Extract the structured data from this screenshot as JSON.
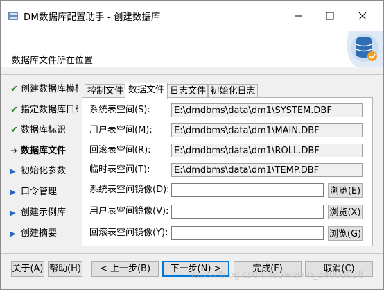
{
  "window": {
    "title": "DM数据库配置助手 - 创建数据库"
  },
  "banner": {
    "title": "数据库文件所在位置"
  },
  "steps": [
    {
      "label": "创建数据库模板",
      "state": "done"
    },
    {
      "label": "指定数据库目录",
      "state": "done"
    },
    {
      "label": "数据库标识",
      "state": "done"
    },
    {
      "label": "数据库文件",
      "state": "current"
    },
    {
      "label": "初始化参数",
      "state": "pending"
    },
    {
      "label": "口令管理",
      "state": "pending"
    },
    {
      "label": "创建示例库",
      "state": "pending"
    },
    {
      "label": "创建摘要",
      "state": "pending"
    }
  ],
  "tabs": [
    {
      "label": "控制文件"
    },
    {
      "label": "数据文件"
    },
    {
      "label": "日志文件"
    },
    {
      "label": "初始化日志"
    }
  ],
  "active_tab": "数据文件",
  "rows": [
    {
      "label": "系统表空间(S):",
      "value": "E:\\dmdbms\\data\\dm1\\SYSTEM.DBF"
    },
    {
      "label": "用户表空间(M):",
      "value": "E:\\dmdbms\\data\\dm1\\MAIN.DBF"
    },
    {
      "label": "回滚表空间(R):",
      "value": "E:\\dmdbms\\data\\dm1\\ROLL.DBF"
    },
    {
      "label": "临时表空间(T):",
      "value": "E:\\dmdbms\\data\\dm1\\TEMP.DBF"
    }
  ],
  "mirror_rows": [
    {
      "label": "系统表空间镜像(D):",
      "value": "",
      "browse": "浏览(E)"
    },
    {
      "label": "用户表空间镜像(V):",
      "value": "",
      "browse": "浏览(X)"
    },
    {
      "label": "回滚表空间镜像(Y):",
      "value": "",
      "browse": "浏览(G)"
    }
  ],
  "buttons": {
    "about": "关于(A)",
    "help": "帮助(H)",
    "prev": "< 上一步(B)",
    "next": "下一步(N) >",
    "finish": "完成(F)",
    "cancel": "取消(C)"
  },
  "watermark": "https://blog.csdn.net/weixin_34008028",
  "colors": {
    "accent": "#0078d7",
    "check": "#1a7f1a",
    "pending_marker": "#1f64c8"
  },
  "icons": {
    "app": "app-icon",
    "minimize": "minimize-icon",
    "maximize": "maximize-icon",
    "close": "close-icon",
    "banner": "database-check-icon"
  }
}
